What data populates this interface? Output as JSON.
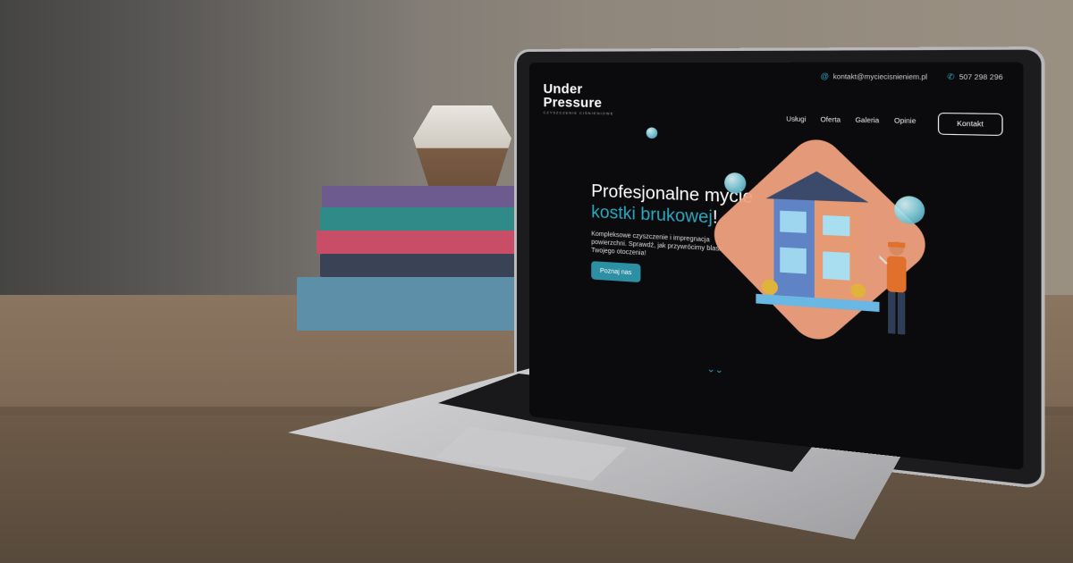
{
  "topbar": {
    "email": "kontakt@myciecisnieniem.pl",
    "phone": "507 298 296",
    "email_icon": "at-sign-icon",
    "phone_icon": "phone-icon"
  },
  "brand": {
    "line1": "Under",
    "line2": "Pressure",
    "tagline": "CZYSZCZENIE CIŚNIENIOWE"
  },
  "nav": {
    "items": [
      "Usługi",
      "Oferta",
      "Galeria",
      "Opinie"
    ],
    "contact_button": "Kontakt"
  },
  "hero": {
    "title_line1": "Profesjonalne mycie",
    "title_line2": "kostki brukowej",
    "title_suffix": "!",
    "description": "Kompleksowe czyszczenie i impregnacja powierzchni. Sprawdź, jak przywrócimy blask Twojego otoczenia!",
    "cta_label": "Poznaj nas"
  },
  "colors": {
    "accent": "#2ea7bf",
    "background": "#0b0b0d",
    "illustration_peach": "#f0a27f"
  },
  "icons": {
    "scroll_indicator": "chevrons-down-icon"
  }
}
